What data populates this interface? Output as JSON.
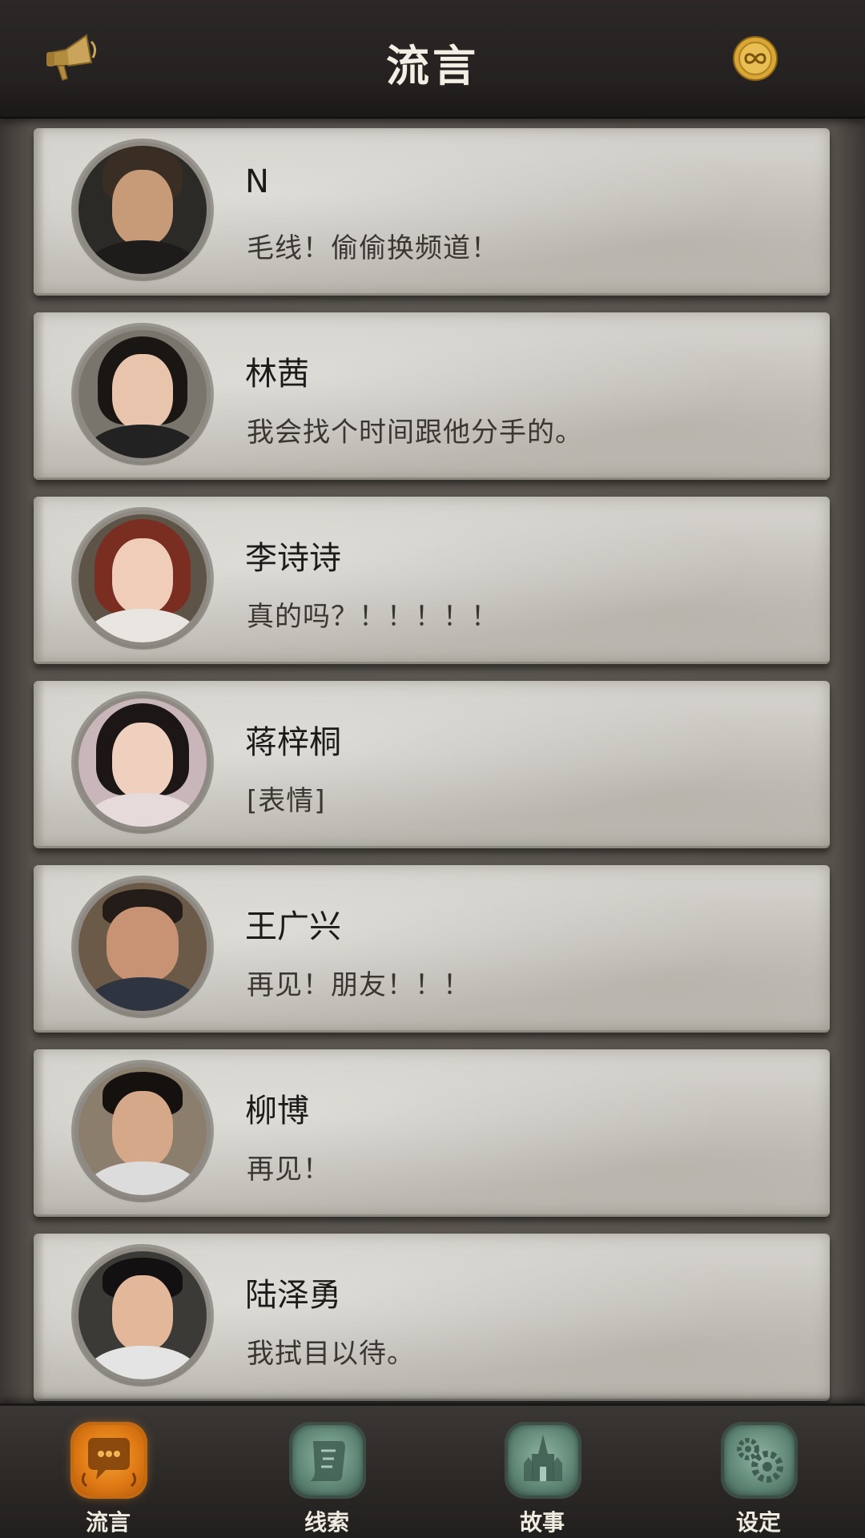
{
  "header": {
    "title": "流言",
    "left_icon": "megaphone-icon",
    "right_icon": "infinity-coin-icon"
  },
  "messages": [
    {
      "name": "N",
      "preview": "毛线！偷偷换频道！"
    },
    {
      "name": "林茜",
      "preview": "我会找个时间跟他分手的。"
    },
    {
      "name": "李诗诗",
      "preview": "真的吗？！！！！！"
    },
    {
      "name": "蒋梓桐",
      "preview": "[表情]"
    },
    {
      "name": "王广兴",
      "preview": "再见！朋友！！！"
    },
    {
      "name": "柳博",
      "preview": "再见！"
    },
    {
      "name": "陆泽勇",
      "preview": "我拭目以待。"
    }
  ],
  "nav": {
    "items": [
      {
        "label": "流言",
        "icon": "chat-bubble-icon",
        "active": true
      },
      {
        "label": "线索",
        "icon": "scroll-icon",
        "active": false
      },
      {
        "label": "故事",
        "icon": "castle-icon",
        "active": false
      },
      {
        "label": "设定",
        "icon": "gears-icon",
        "active": false
      }
    ]
  },
  "colors": {
    "accent_active": "#e07b15",
    "inactive_tab": "#5f8675",
    "header_bg": "#242120",
    "card_bg": "#cac8c1"
  }
}
